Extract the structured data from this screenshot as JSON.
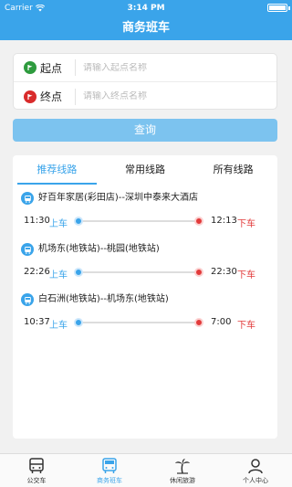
{
  "status_bar": {
    "carrier": "Carrier",
    "time": "3:14 PM"
  },
  "nav": {
    "title": "商务班车"
  },
  "search": {
    "start_label": "起点",
    "start_placeholder": "请输入起点名称",
    "end_label": "终点",
    "end_placeholder": "请输入终点名称",
    "query_label": "查询"
  },
  "tabs": [
    {
      "label": "推荐线路",
      "active": true
    },
    {
      "label": "常用线路",
      "active": false
    },
    {
      "label": "所有线路",
      "active": false
    }
  ],
  "routes": [
    {
      "name": "好百年家居(彩田店)--深圳中泰来大酒店",
      "depart_time": "11:30",
      "depart_label": "上车",
      "arrive_time": "12:13",
      "arrive_label": "下车"
    },
    {
      "name": "机场东(地铁站)--桃园(地铁站)",
      "depart_time": "22:26",
      "depart_label": "上车",
      "arrive_time": "22:30",
      "arrive_label": "下车"
    },
    {
      "name": "白石洲(地铁站)--机场东(地铁站)",
      "depart_time": "10:37",
      "depart_label": "上车",
      "arrive_time": "7:00",
      "arrive_label": "下车"
    }
  ],
  "tab_bar": [
    {
      "label": "公交车",
      "icon": "bus-icon",
      "active": false
    },
    {
      "label": "商务班车",
      "icon": "shuttle-bus-icon",
      "active": true
    },
    {
      "label": "休闲旅游",
      "icon": "palm-tree-icon",
      "active": false
    },
    {
      "label": "个人中心",
      "icon": "person-icon",
      "active": false
    }
  ],
  "colors": {
    "primary": "#3aa4ea",
    "button": "#7cc3ef",
    "arrive": "#e23a3a",
    "start_flag": "#2e9b3e",
    "end_flag": "#d92b2b"
  }
}
